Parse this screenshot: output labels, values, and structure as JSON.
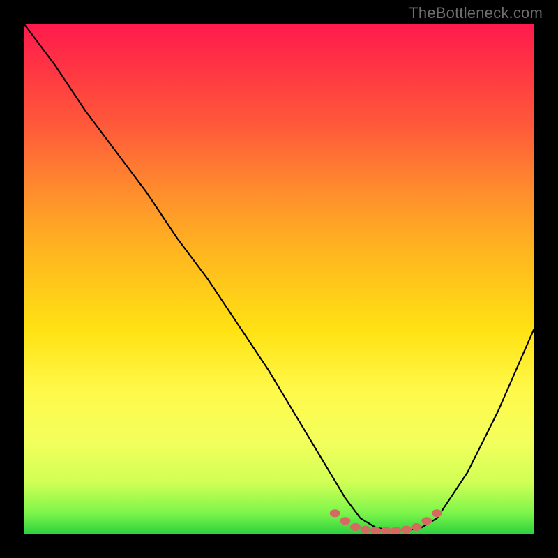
{
  "watermark": "TheBottleneck.com",
  "chart_data": {
    "type": "line",
    "title": "",
    "xlabel": "",
    "ylabel": "",
    "xlim": [
      0,
      100
    ],
    "ylim": [
      0,
      100
    ],
    "grid": false,
    "legend": false,
    "series": [
      {
        "name": "bottleneck-curve",
        "color": "#000000",
        "x": [
          0,
          6,
          12,
          18,
          24,
          30,
          36,
          42,
          48,
          54,
          60,
          63,
          66,
          69,
          72,
          75,
          78,
          81,
          87,
          93,
          100
        ],
        "values": [
          100,
          92,
          83,
          75,
          67,
          58,
          50,
          41,
          32,
          22,
          12,
          7,
          3,
          1.2,
          0.6,
          0.6,
          1.2,
          3,
          12,
          24,
          40
        ]
      }
    ],
    "markers": {
      "name": "bottom-dots",
      "color": "#d46a62",
      "x": [
        61,
        63,
        65,
        67,
        69,
        71,
        73,
        75,
        77,
        79,
        81
      ],
      "values": [
        4.0,
        2.5,
        1.3,
        0.8,
        0.6,
        0.6,
        0.6,
        0.8,
        1.3,
        2.5,
        4.0
      ]
    }
  }
}
